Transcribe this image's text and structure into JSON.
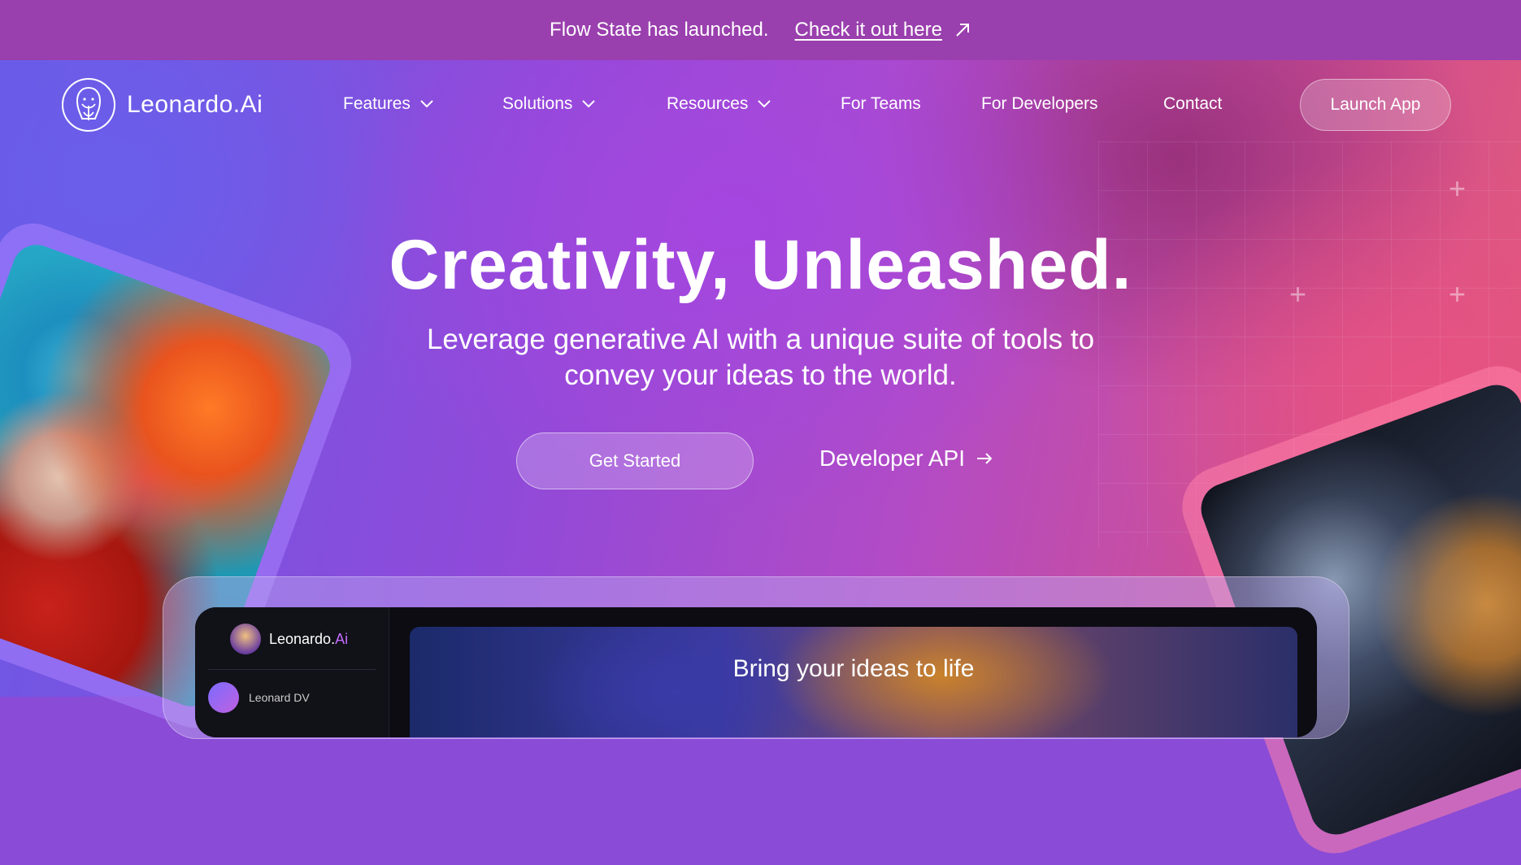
{
  "announcement": {
    "message": "Flow State has launched.",
    "link_label": "Check it out here"
  },
  "brand": {
    "name": "Leonardo.Ai"
  },
  "nav": {
    "items": [
      {
        "label": "Features",
        "dropdown": true
      },
      {
        "label": "Solutions",
        "dropdown": true
      },
      {
        "label": "Resources",
        "dropdown": true
      },
      {
        "label": "For Teams",
        "dropdown": false
      },
      {
        "label": "For Developers",
        "dropdown": false
      },
      {
        "label": "Contact",
        "dropdown": false
      }
    ],
    "launch_label": "Launch App"
  },
  "hero": {
    "headline": "Creativity, Unleashed.",
    "subline_1": "Leverage generative AI with a unique suite of tools to",
    "subline_2": "convey your ideas to the world.",
    "primary_cta": "Get Started",
    "secondary_cta": "Developer API"
  },
  "preview": {
    "logo_main": "Leonardo.",
    "logo_accent": "Ai",
    "user_label": "Leonard DV",
    "banner_text": "Bring your ideas to life"
  },
  "colors": {
    "announcement_bg": "#9a3fae",
    "accent_purple": "#8f4ad9",
    "accent_pink": "#e25a78"
  }
}
